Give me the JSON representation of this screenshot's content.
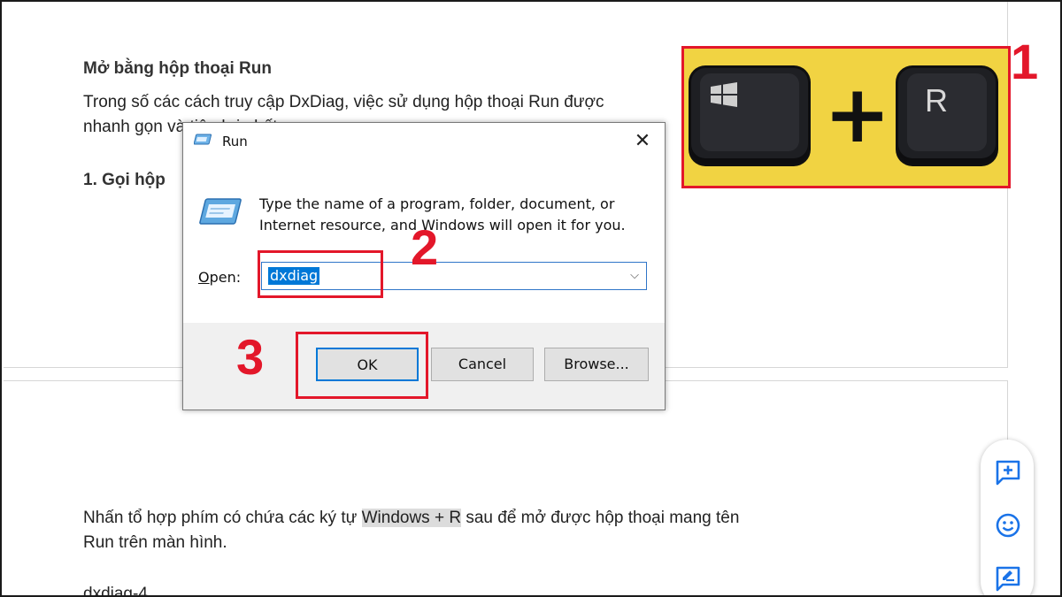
{
  "document": {
    "heading": "Mở bằng hộp thoại Run",
    "para1_line1": "Trong số các cách truy cập DxDiag, việc sử dụng hộp thoại Run được",
    "para1_line2": "nhanh gọn và tiện lợi nhất.",
    "step_heading": "1. Gọi hộp",
    "para2_pre": "Nhấn tổ hợp phím có chứa các ký tự ",
    "para2_highlight": "Windows + R",
    "para2_post": " sau để mở được hộp thoại mang tên",
    "para2_line2": "Run trên màn hình.",
    "caption_partial": "dxdiag-4"
  },
  "run_dialog": {
    "title": "Run",
    "close_glyph": "✕",
    "description": "Type the name of a program, folder, document, or Internet resource, and Windows will open it for you.",
    "open_label_prefix": "O",
    "open_label_rest": "pen:",
    "input_value": "dxdiag",
    "dropdown_glyph": "⌵",
    "ok_label": "OK",
    "cancel_label": "Cancel",
    "browse_label": "Browse..."
  },
  "annotations": {
    "step1": "1",
    "step2": "2",
    "step3": "3",
    "key_r": "R",
    "plus": "+"
  },
  "colors": {
    "annotation_red": "#e3172a",
    "keys_background": "#f1d342",
    "selection_blue": "#0078d7",
    "toolbar_icon_blue": "#1a73e8"
  },
  "side_toolbar": {
    "icons": [
      "add-comment-icon",
      "emoji-icon",
      "suggest-edit-icon"
    ]
  }
}
